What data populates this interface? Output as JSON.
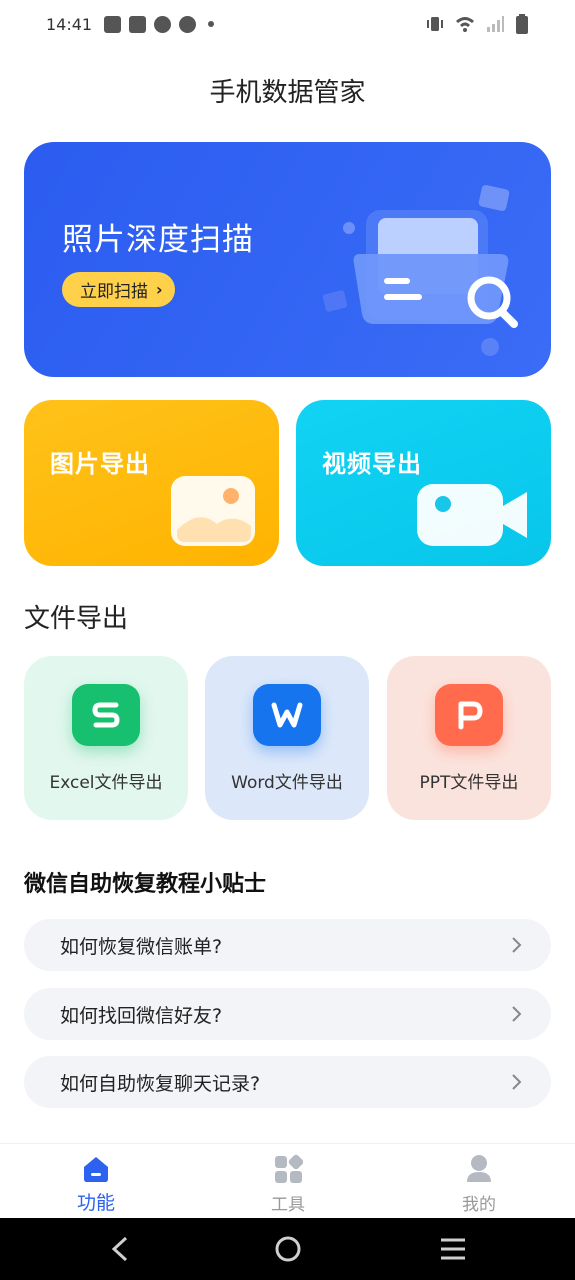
{
  "status_bar": {
    "time": "14:41",
    "left_icons": [
      "bag-icon",
      "bag-icon",
      "compass-icon",
      "compass-icon",
      "dot-icon"
    ],
    "right_icons": [
      "vibrate-icon",
      "wifi-icon",
      "signal-icon",
      "battery-icon"
    ]
  },
  "app": {
    "title": "手机数据管家"
  },
  "banner": {
    "title": "照片深度扫描",
    "button_label": "立即扫描",
    "button_icon": "chevron-right-icon",
    "art_icon": "folder-search-icon"
  },
  "cards": {
    "photo_export": {
      "title": "图片导出",
      "icon": "image-icon"
    },
    "video_export": {
      "title": "视频导出",
      "icon": "video-camera-icon"
    }
  },
  "file_export": {
    "section_title": "文件导出",
    "items": [
      {
        "label": "Excel文件导出",
        "icon": "excel-icon",
        "letter": "S"
      },
      {
        "label": "Word文件导出",
        "icon": "word-icon",
        "letter": "W"
      },
      {
        "label": "PPT文件导出",
        "icon": "ppt-icon",
        "letter": "P"
      }
    ]
  },
  "tips": {
    "title": "微信自助恢复教程小贴士",
    "items": [
      {
        "label": "如何恢复微信账单?"
      },
      {
        "label": "如何找回微信好友?"
      },
      {
        "label": "如何自助恢复聊天记录?"
      }
    ]
  },
  "tab_bar": {
    "tabs": [
      {
        "label": "功能",
        "icon": "home-icon",
        "active": true
      },
      {
        "label": "工具",
        "icon": "grid-icon",
        "active": false
      },
      {
        "label": "我的",
        "icon": "user-icon",
        "active": false
      }
    ]
  },
  "colors": {
    "banner": "#2b5cf0",
    "scan_button": "#ffd04a",
    "photo_card": "#ffb300",
    "video_card": "#07c6ea",
    "excel": "#17c06e",
    "word": "#1574ee",
    "ppt": "#ff6b4c",
    "active_tab": "#2c62ef"
  }
}
